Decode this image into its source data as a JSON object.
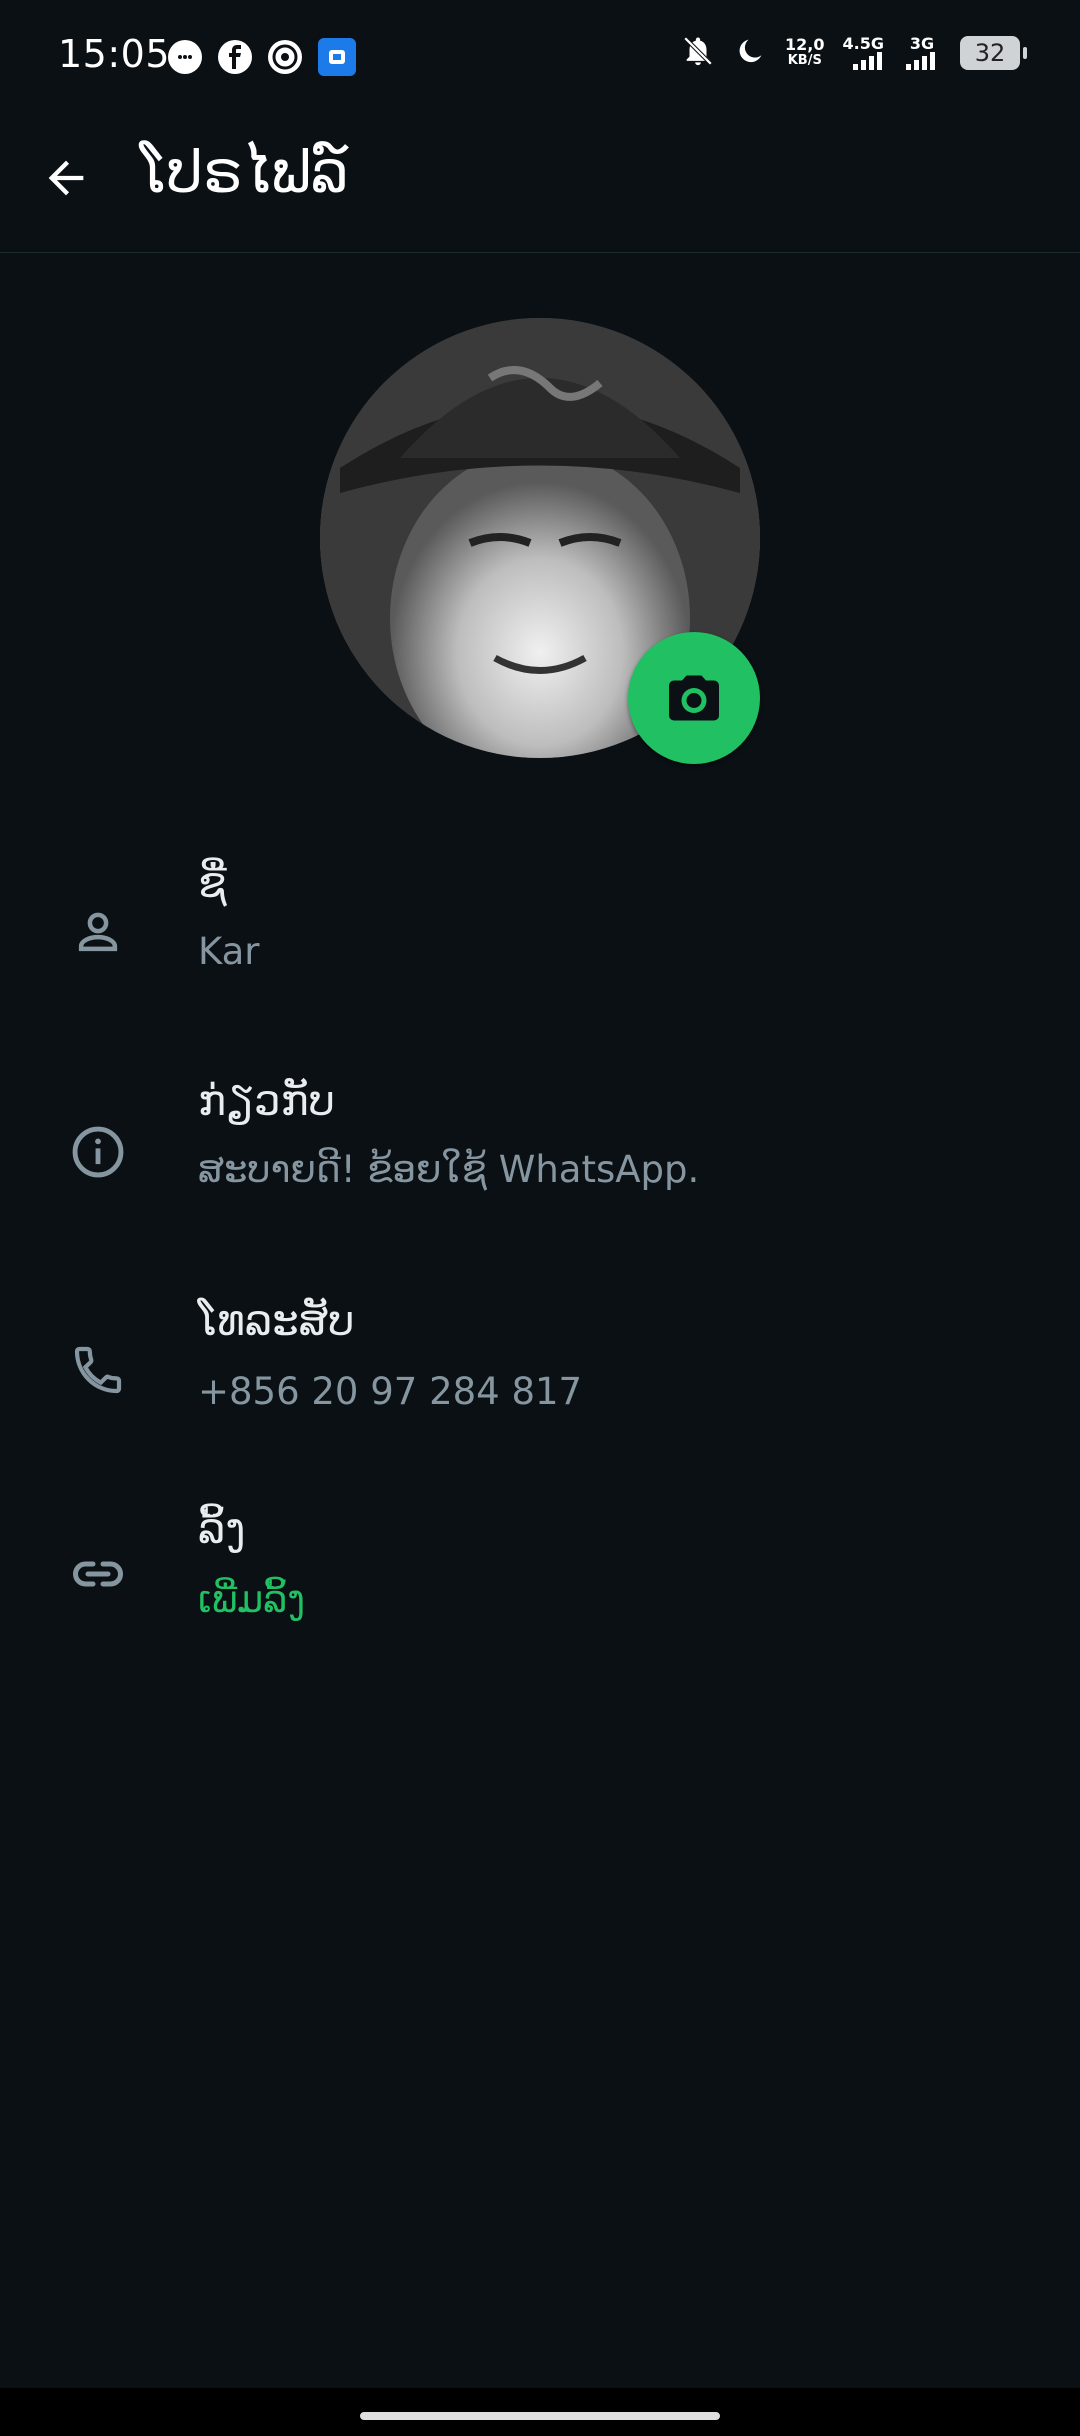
{
  "status_bar": {
    "time": "15:05",
    "net_speed_value": "12,0",
    "net_speed_unit": "KB/S",
    "sim1": "4.5G",
    "sim2": "3G",
    "battery": "32"
  },
  "header": {
    "title": "ໂປຣໄຟລ໌"
  },
  "profile": {
    "name_label": "ຊື່",
    "name_value": "Kar",
    "about_label": "ກ່ຽວກັບ",
    "about_value": "ສະບາຍດີ! ຂ້ອຍໃຊ້ WhatsApp.",
    "phone_label": "ໂທລະສັບ",
    "phone_value": "+856 20 97 284 817",
    "links_label": "ລິ້ງ",
    "links_value": "ເພີ່ມລິ້ງ"
  },
  "colors": {
    "background": "#0b1014",
    "accent": "#21c063",
    "secondary_text": "#8696a0"
  },
  "icons": {
    "back": "arrow-left-icon",
    "camera": "camera-icon",
    "name": "person-icon",
    "about": "info-icon",
    "phone": "phone-icon",
    "links": "link-icon"
  }
}
